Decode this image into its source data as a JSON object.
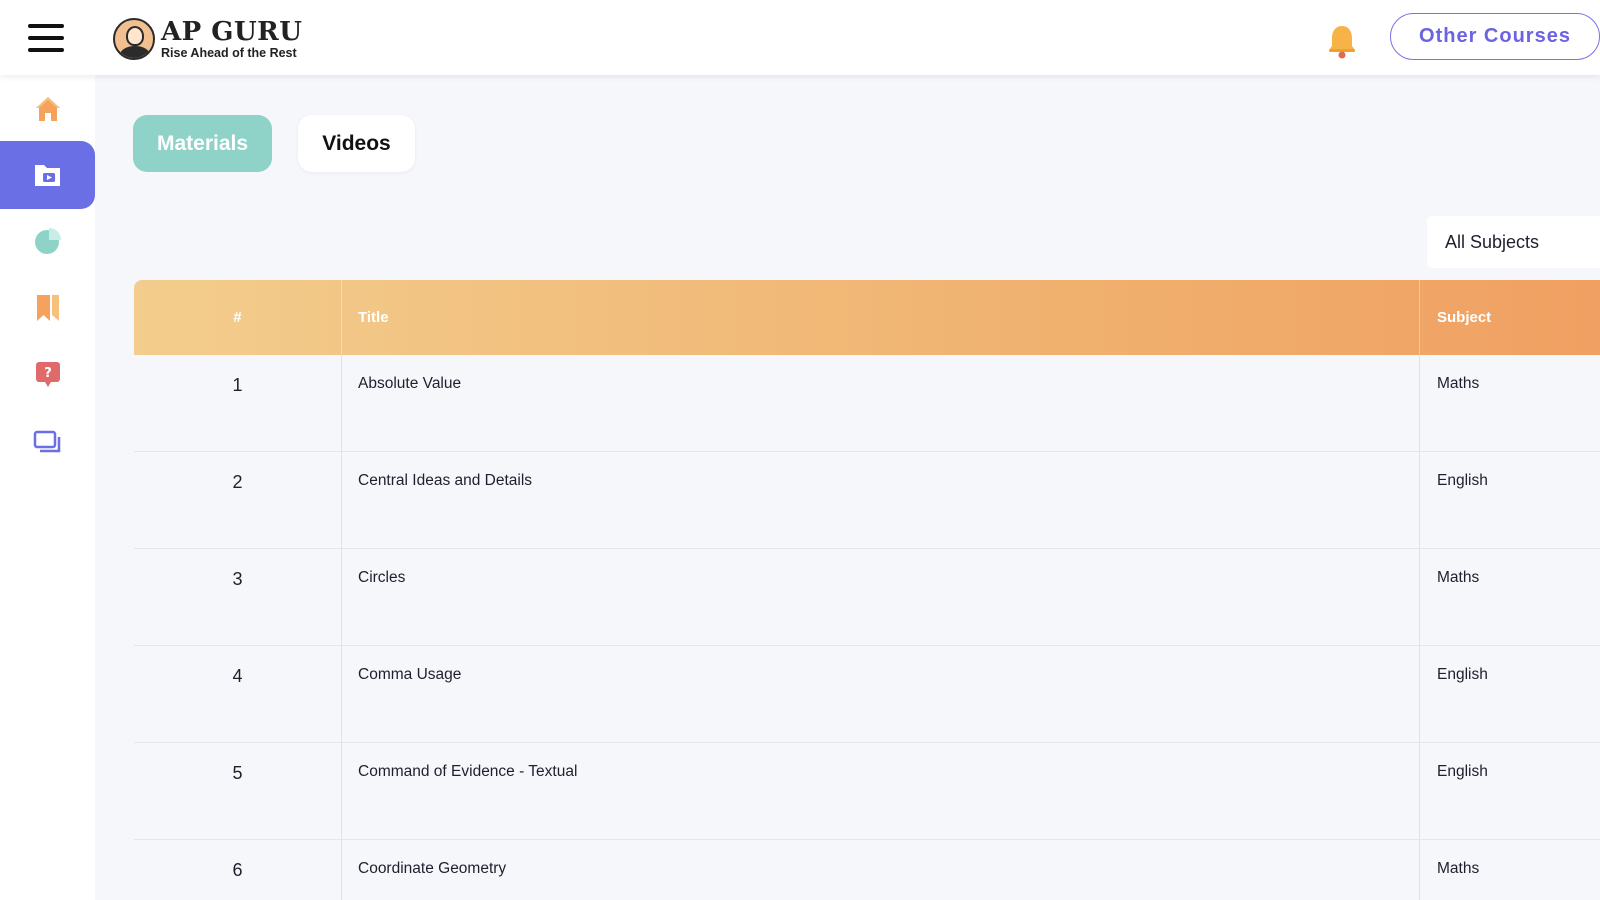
{
  "header": {
    "logo_title": "AP GURU",
    "logo_tagline": "Rise Ahead of the Rest",
    "other_courses_label": "Other Courses"
  },
  "sidebar": {
    "items": [
      {
        "name": "home",
        "icon": "home-icon",
        "color": "#f5a25c"
      },
      {
        "name": "materials",
        "icon": "folder-video-icon",
        "color": "#ffffff",
        "active": true
      },
      {
        "name": "analytics",
        "icon": "pie-chart-icon",
        "color": "#8fd3c8"
      },
      {
        "name": "bookmarks",
        "icon": "bookmark-icon",
        "color": "#f5a25c"
      },
      {
        "name": "doubts",
        "icon": "question-icon",
        "color": "#e06a6a"
      },
      {
        "name": "classes",
        "icon": "screens-icon",
        "color": "#6b6fe6"
      }
    ]
  },
  "tabs": {
    "materials_label": "Materials",
    "videos_label": "Videos",
    "active": "Materials"
  },
  "filter": {
    "subject_selected": "All Subjects"
  },
  "table": {
    "headers": {
      "num": "#",
      "title": "Title",
      "subject": "Subject"
    },
    "rows": [
      {
        "num": "1",
        "title": "Absolute Value",
        "subject": "Maths"
      },
      {
        "num": "2",
        "title": "Central Ideas and Details",
        "subject": "English"
      },
      {
        "num": "3",
        "title": "Circles",
        "subject": "Maths"
      },
      {
        "num": "4",
        "title": "Comma Usage",
        "subject": "English"
      },
      {
        "num": "5",
        "title": "Command of Evidence - Textual",
        "subject": "English"
      },
      {
        "num": "6",
        "title": "Coordinate Geometry",
        "subject": "Maths"
      }
    ]
  },
  "colors": {
    "accent": "#6b6fe6",
    "teal": "#8fd3c8",
    "orange": "#f0a062",
    "header_gradient_start": "#f3cd8d"
  }
}
